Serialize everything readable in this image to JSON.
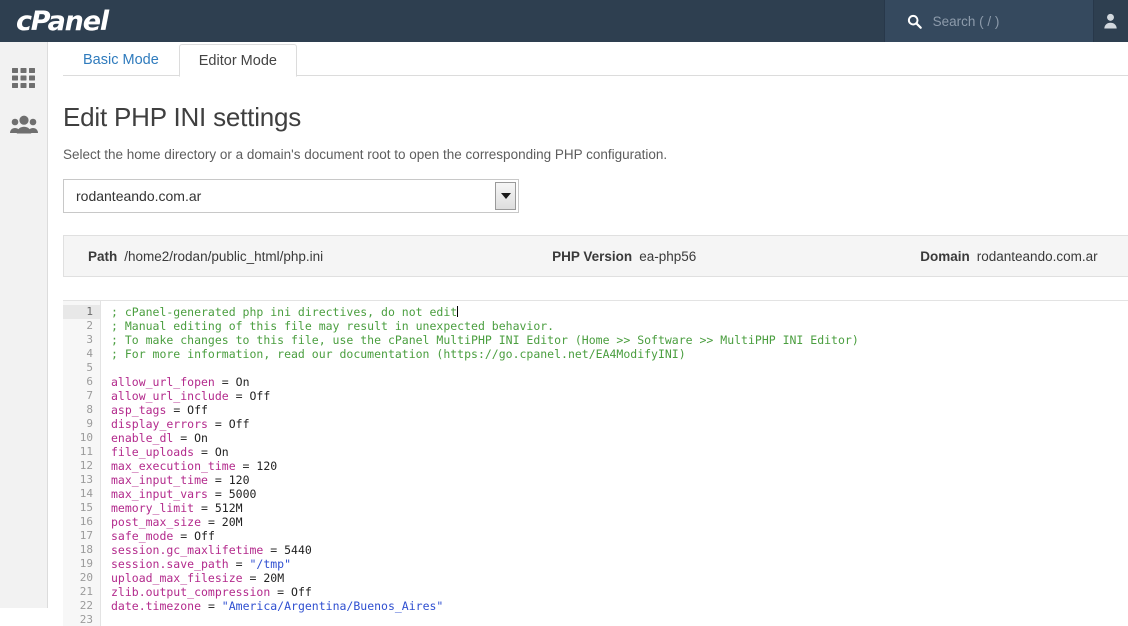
{
  "header": {
    "brand": "cPanel",
    "search_icon": "search-icon",
    "search_placeholder": "Search ( / )",
    "search_value": "",
    "user_icon": "user-icon"
  },
  "sidebar": {
    "items": [
      {
        "icon": "grid-apps-icon",
        "name": "sidebar-item-apps"
      },
      {
        "icon": "users-group-icon",
        "name": "sidebar-item-users"
      }
    ]
  },
  "tabs": [
    {
      "label": "Basic Mode",
      "active": false
    },
    {
      "label": "Editor Mode",
      "active": true
    }
  ],
  "page": {
    "title": "Edit PHP INI settings",
    "subtitle": "Select the home directory or a domain's document root to open the corresponding PHP configuration."
  },
  "domain_select": {
    "value": "rodanteando.com.ar",
    "caret_icon": "chevron-down-icon"
  },
  "info_bar": {
    "path_label": "Path",
    "path_value": "/home2/rodan/public_html/php.ini",
    "php_version_label": "PHP Version",
    "php_version_value": "ea-php56",
    "domain_label": "Domain",
    "domain_value": "rodanteando.com.ar"
  },
  "editor": {
    "active_line": 1,
    "cursor_line": 1,
    "line_numbers": [
      1,
      2,
      3,
      4,
      5,
      6,
      7,
      8,
      9,
      10,
      11,
      12,
      13,
      14,
      15,
      16,
      17,
      18,
      19,
      20,
      21,
      22,
      23
    ],
    "lines": [
      {
        "n": 1,
        "type": "comment",
        "text": "; cPanel-generated php ini directives, do not edit",
        "cursor": true
      },
      {
        "n": 2,
        "type": "comment",
        "text": "; Manual editing of this file may result in unexpected behavior."
      },
      {
        "n": 3,
        "type": "comment",
        "text": "; To make changes to this file, use the cPanel MultiPHP INI Editor (Home >> Software >> MultiPHP INI Editor)"
      },
      {
        "n": 4,
        "type": "comment",
        "text": "; For more information, read our documentation (https://go.cpanel.net/EA4ModifyINI)"
      },
      {
        "n": 5,
        "type": "blank",
        "text": ""
      },
      {
        "n": 6,
        "type": "directive",
        "key": "allow_url_fopen",
        "value": "On",
        "value_type": "const"
      },
      {
        "n": 7,
        "type": "directive",
        "key": "allow_url_include",
        "value": "Off",
        "value_type": "const"
      },
      {
        "n": 8,
        "type": "directive",
        "key": "asp_tags",
        "value": "Off",
        "value_type": "const"
      },
      {
        "n": 9,
        "type": "directive",
        "key": "display_errors",
        "value": "Off",
        "value_type": "const"
      },
      {
        "n": 10,
        "type": "directive",
        "key": "enable_dl",
        "value": "On",
        "value_type": "const"
      },
      {
        "n": 11,
        "type": "directive",
        "key": "file_uploads",
        "value": "On",
        "value_type": "const"
      },
      {
        "n": 12,
        "type": "directive",
        "key": "max_execution_time",
        "value": "120",
        "value_type": "num"
      },
      {
        "n": 13,
        "type": "directive",
        "key": "max_input_time",
        "value": "120",
        "value_type": "num"
      },
      {
        "n": 14,
        "type": "directive",
        "key": "max_input_vars",
        "value": "5000",
        "value_type": "num"
      },
      {
        "n": 15,
        "type": "directive",
        "key": "memory_limit",
        "value": "512M",
        "value_type": "num"
      },
      {
        "n": 16,
        "type": "directive",
        "key": "post_max_size",
        "value": "20M",
        "value_type": "num"
      },
      {
        "n": 17,
        "type": "directive",
        "key": "safe_mode",
        "value": "Off",
        "value_type": "const"
      },
      {
        "n": 18,
        "type": "directive",
        "key": "session.gc_maxlifetime",
        "value": "5440",
        "value_type": "num"
      },
      {
        "n": 19,
        "type": "directive",
        "key": "session.save_path",
        "value": "\"/tmp\"",
        "value_type": "str"
      },
      {
        "n": 20,
        "type": "directive",
        "key": "upload_max_filesize",
        "value": "20M",
        "value_type": "num"
      },
      {
        "n": 21,
        "type": "directive",
        "key": "zlib.output_compression",
        "value": "Off",
        "value_type": "const"
      },
      {
        "n": 22,
        "type": "directive",
        "key": "date.timezone",
        "value": "\"America/Argentina/Buenos_Aires\"",
        "value_type": "str"
      },
      {
        "n": 23,
        "type": "blank",
        "text": ""
      }
    ]
  },
  "colors": {
    "header_bg": "#2e3f50",
    "search_bg": "#35495e",
    "tab_link": "#2f7bbd",
    "comment": "#4a9e3f",
    "key": "#b32a8c",
    "string": "#2f4fd0"
  }
}
